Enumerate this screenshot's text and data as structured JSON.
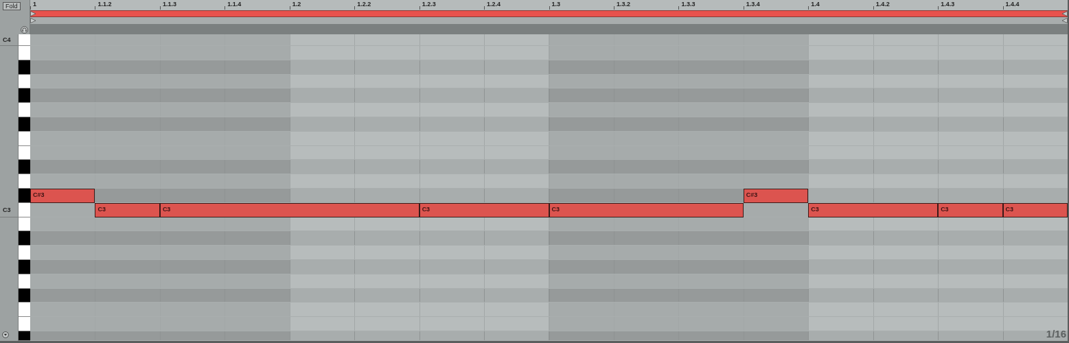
{
  "fold_button": "Fold",
  "ruler": [
    "1",
    "1.1.2",
    "1.1.3",
    "1.1.4",
    "1.2",
    "1.2.2",
    "1.2.3",
    "1.2.4",
    "1.3",
    "1.3.2",
    "1.3.3",
    "1.3.4",
    "1.4",
    "1.4.2",
    "1.4.3",
    "1.4.4"
  ],
  "keys": [
    {
      "kind": "white",
      "label": "C4"
    },
    {
      "kind": "white"
    },
    {
      "kind": "black"
    },
    {
      "kind": "white"
    },
    {
      "kind": "black"
    },
    {
      "kind": "white"
    },
    {
      "kind": "black"
    },
    {
      "kind": "white"
    },
    {
      "kind": "white"
    },
    {
      "kind": "black"
    },
    {
      "kind": "white"
    },
    {
      "kind": "black",
      "notes": [
        "C#3",
        "C#3"
      ]
    },
    {
      "kind": "white",
      "label": "C3",
      "notes": [
        "C3",
        "C3",
        "C3",
        "C3",
        "C3",
        "C3",
        "C3"
      ]
    },
    {
      "kind": "white"
    },
    {
      "kind": "black"
    },
    {
      "kind": "white"
    },
    {
      "kind": "black"
    },
    {
      "kind": "white"
    },
    {
      "kind": "black"
    },
    {
      "kind": "white"
    },
    {
      "kind": "white"
    },
    {
      "kind": "black"
    }
  ],
  "grid_label": "1/16"
}
